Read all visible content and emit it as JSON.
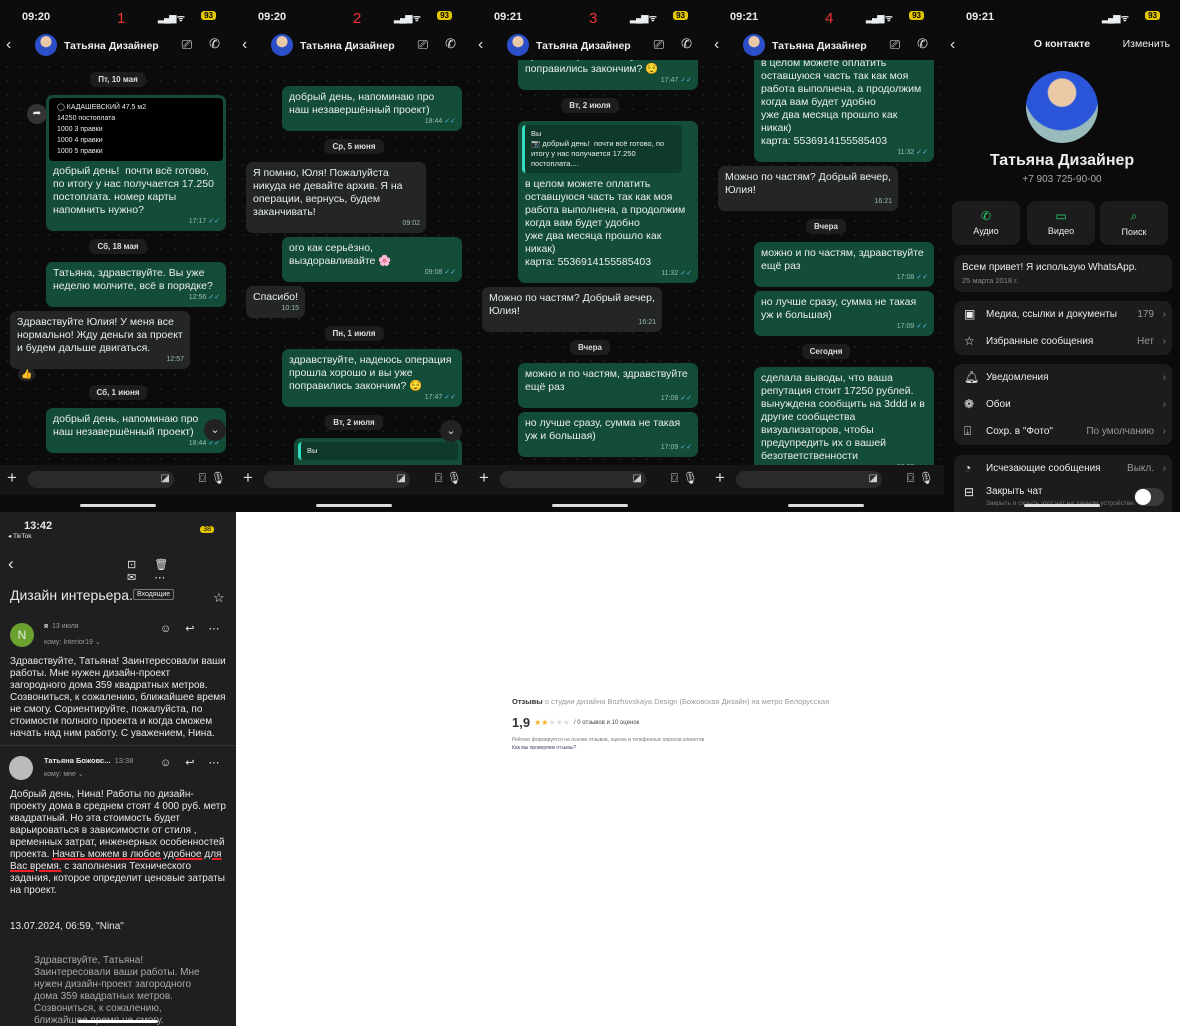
{
  "chats": [
    {
      "time": "09:20",
      "label": "1",
      "battery": "93",
      "contact": "Татьяна Дизайнер",
      "messages": [
        {
          "type": "date",
          "text": "Пт, 10 мая"
        },
        {
          "type": "out",
          "image": [
            "◯ КАДАШЕВСКИЙ 47.5 м2",
            "14250 постоплата",
            "1000 3 правки",
            "1000 4 правки",
            "1000 5 правки"
          ],
          "text": "добрый день!  почти всё готово, по итогу у нас получается 17.250 постоплата. номер карты напомнить нужно?",
          "time": "17:17"
        },
        {
          "type": "date",
          "text": "Сб, 18 мая"
        },
        {
          "type": "out",
          "text": "Татьяна, здравствуйте. Вы уже неделю молчите, всё в порядке?",
          "time": "12:56"
        },
        {
          "type": "in",
          "text": "Здравствуйте Юлия! У меня все нормально! Жду деньги за проект и будем дальше двигаться.",
          "time": "12:57",
          "reaction": "👍"
        },
        {
          "type": "date",
          "text": "Сб, 1 июня"
        },
        {
          "type": "out",
          "text": "добрый день, напоминаю про наш незавершённый проект)",
          "time": "18:44"
        }
      ]
    },
    {
      "time": "09:20",
      "label": "2",
      "battery": "93",
      "contact": "Татьяна Дизайнер",
      "messages": [
        {
          "type": "out",
          "text": "добрый день, напоминаю про наш незавершённый проект)",
          "time": "18:44"
        },
        {
          "type": "date",
          "text": "Ср, 5 июня"
        },
        {
          "type": "in",
          "text": "Я помню, Юля! Пожалуйста никуда не девайте архив. Я на операции, вернусь, будем заканчивать!",
          "time": "09:02"
        },
        {
          "type": "out",
          "text": "ого как серьёзно, выздоравливайте 🌸",
          "time": "09:08"
        },
        {
          "type": "in",
          "text": "Спасибо!",
          "time": "10:15"
        },
        {
          "type": "date",
          "text": "Пн, 1 июля"
        },
        {
          "type": "out",
          "text": "здравствуйте, надеюсь операция прошла хорошо и вы уже поправились закончим? 😌",
          "time": "17:47"
        },
        {
          "type": "date",
          "text": "Вт, 2 июля"
        },
        {
          "type": "out",
          "quote": "Вы",
          "text": "",
          "time": ""
        }
      ]
    },
    {
      "time": "09:21",
      "label": "3",
      "battery": "93",
      "contact": "Татьяна Дизайнер",
      "messages": [
        {
          "type": "out",
          "text": "здравствуйте, надеюсь операция прошла хорошо и вы уже поправились закончим? 😌",
          "time": "17:47"
        },
        {
          "type": "date",
          "text": "Вт, 2 июля"
        },
        {
          "type": "out",
          "quote": "Вы\n📷 добрый день!  почти всё готово, по итогу у нас получается 17.250 постоплата....",
          "text": "в целом можете оплатить оставшуюся часть так как моя работа выполнена, а продолжим когда вам будет удобно\nуже два месяца прошло как никак)\nкарта: 5536914155585403",
          "time": "11:32"
        },
        {
          "type": "in",
          "text": "Можно по частям? Добрый вечер, Юлия!",
          "time": "16:21"
        },
        {
          "type": "date",
          "text": "Вчера"
        },
        {
          "type": "out",
          "text": "можно и по частям, здравствуйте ещё раз",
          "time": "17:08"
        },
        {
          "type": "out",
          "text": "но лучше сразу, сумма не такая уж и большая)",
          "time": "17:09"
        }
      ]
    },
    {
      "time": "09:21",
      "label": "4",
      "battery": "93",
      "contact": "Татьяна Дизайнер",
      "messages": [
        {
          "type": "out",
          "quote": "Вы\n📷 добрый день!  почти всё готово, по итогу у нас получается 17.250 постоплата....",
          "text": "в целом можете оплатить оставшуюся часть так как моя работа выполнена, а продолжим когда вам будет удобно\nуже два месяца прошло как никак)\nкарта: 5536914155585403",
          "time": "11:32"
        },
        {
          "type": "in",
          "text": "Можно по частям? Добрый вечер, Юлия!",
          "time": "16:21"
        },
        {
          "type": "date",
          "text": "Вчера"
        },
        {
          "type": "out",
          "text": "можно и по частям, здравствуйте ещё раз",
          "time": "17:08"
        },
        {
          "type": "out",
          "text": "но лучше сразу, сумма не такая уж и большая)",
          "time": "17:09"
        },
        {
          "type": "date",
          "text": "Сегодня"
        },
        {
          "type": "out",
          "text": "сделала выводы, что ваша репутация стоит 17250 рублей. вынуждена сообщить на 3ddd и в другие сообщества визуализаторов, чтобы предупредить их о вашей безответственности",
          "time": "09:20"
        }
      ]
    }
  ],
  "contact": {
    "time": "09:21",
    "battery": "93",
    "title": "О контакте",
    "edit": "Изменить",
    "name": "Татьяна Дизайнер",
    "phone": "+7 903 725-90-00",
    "actions": [
      "Аудио",
      "Видео",
      "Поиск"
    ],
    "about": "Всем привет! Я использую WhatsApp.",
    "about_date": "25 марта 2018 г.",
    "rows1": [
      {
        "label": "Медиа, ссылки и документы",
        "value": "179"
      },
      {
        "label": "Избранные сообщения",
        "value": "Нет"
      }
    ],
    "rows2": [
      {
        "label": "Уведомления",
        "value": ""
      },
      {
        "label": "Обои",
        "value": ""
      },
      {
        "label": "Сохр. в \"Фото\"",
        "value": "По умолчанию"
      }
    ],
    "rows3": [
      {
        "label": "Исчезающие сообщения",
        "value": "Выкл."
      }
    ],
    "lock_title": "Закрыть чат",
    "lock_sub": "Закрыть и скрыть этот чат на данном устройстве.",
    "lock_on": false
  },
  "mail": {
    "time": "13:42",
    "back_app": "◂ TikTok",
    "battery": "38",
    "subject": "Дизайн интерьера.",
    "folder": "Входящие",
    "m1": {
      "initial": "N",
      "from": "я",
      "date": "13 июля",
      "to": "кому: Interior19 ⌄",
      "body": "Здравствуйте, Татьяна! Заинтересовали ваши работы. Мне нужен дизайн-проект загородного дома 359 квадратных метров. Созвониться, к сожалению, ближайшее время не смогу. Сориентируйте, пожалуйста, по стоимости полного проекта и когда сможем начать над ним работу. С уважением, Нина."
    },
    "m2": {
      "from": "Татьяна Божовс...",
      "date": "13:38",
      "to": "кому: мне ⌄",
      "body_a": "Добрый день, Нина! Работы по дизайн-проекту дома в среднем стоят 4 000 руб. метр квадратный. Но эта стоимость будет варьироваться в зависимости от стиля , временных затрат, инженерных особенностей проекта. ",
      "body_hl": "Начать можем в любое удобное для Вас время.",
      "body_b": " с заполнения Технического задания, которое определит ценовые затраты на проект."
    },
    "quote_head": "13.07.2024, 06:59, \"Nina\"",
    "quote_body": "Здравствуйте, Татьяна! Заинтересовали ваши работы. Мне нужен дизайн-проект загородного дома 359 квадратных метров. Созвониться, к сожалению, ближайшее время не смогу."
  },
  "reviews": {
    "title": "Отзывы",
    "subtitle": "о студии дизайна Bozhovskaya Design (Божовская Дизайн) на метро Белорусская",
    "rating": "1,9",
    "stars": 1.9,
    "count": "/  0 отзывов и 10 оценок",
    "note": "Рейтинг формируется на основе отзывов, оценок и телефонных опросов клиентов",
    "link": "Как мы проверяем отзывы?"
  }
}
